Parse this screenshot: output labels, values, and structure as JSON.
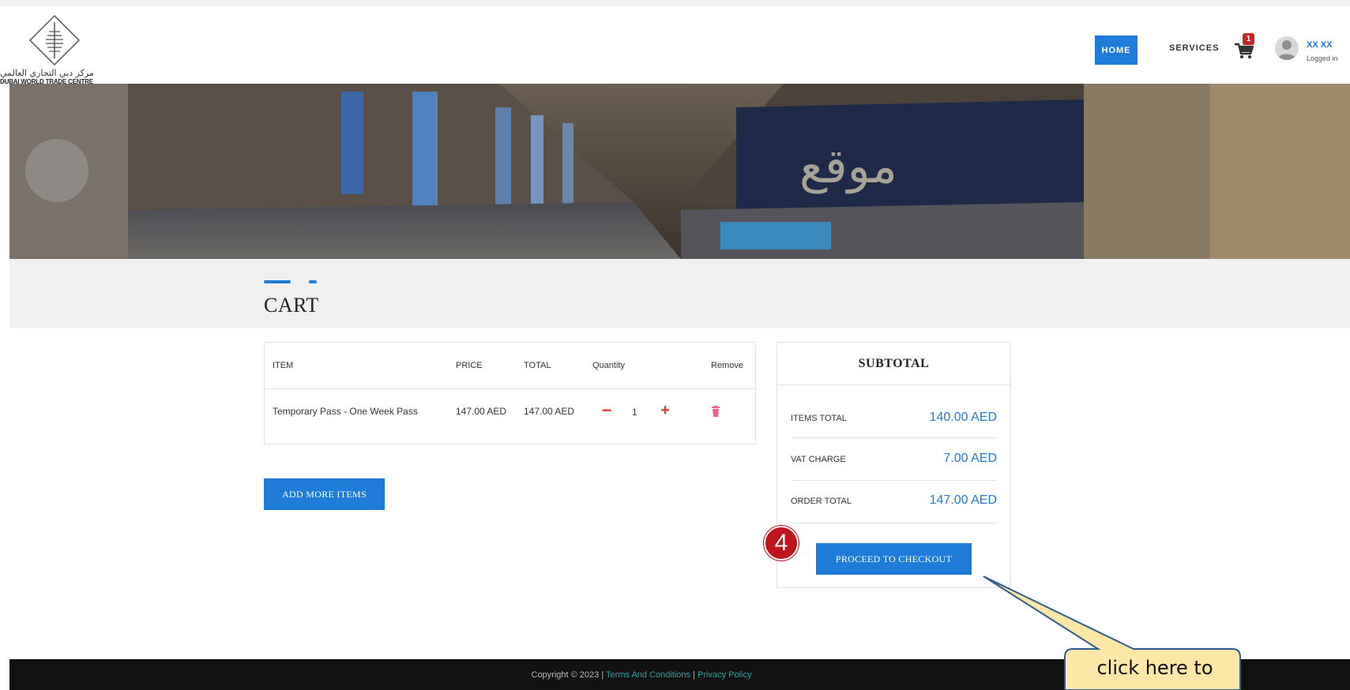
{
  "logo": {
    "arabic_text": "مركز دبي التجاري العالمي",
    "english_text": "DUBAI WORLD TRADE CENTRE"
  },
  "nav": {
    "home_label": "HOME",
    "services_label": "SERVICES",
    "cart_count": "1",
    "user_name": "XX XX",
    "user_status": "Logged in"
  },
  "page": {
    "title": "CART"
  },
  "cart": {
    "columns": [
      "ITEM",
      "PRICE",
      "TOTAL",
      "Quantity",
      "Remove"
    ],
    "rows": [
      {
        "item": "Temporary Pass - One Week Pass",
        "price": "147.00 AED",
        "total": "147.00 AED",
        "quantity": "1",
        "minus_symbol": "−",
        "plus_symbol": "+"
      }
    ],
    "add_more_label": "ADD MORE ITEMS"
  },
  "subtotal": {
    "title": "SUBTOTAL",
    "items_total_label": "ITEMS TOTAL",
    "items_total_value": "140.00 AED",
    "vat_label": "VAT CHARGE",
    "vat_value": "7.00 AED",
    "order_total_label": "ORDER TOTAL",
    "order_total_value": "147.00 AED",
    "checkout_label": "PROCEED TO CHECKOUT"
  },
  "annotation": {
    "step_number": "4",
    "callout_text": "click here to"
  },
  "footer": {
    "copyright": "Copyright © 2023 | ",
    "terms_label": "Terms And Conditions",
    "divider": " | ",
    "privacy_label": "Privacy Policy"
  },
  "colors": {
    "accent": "#1e7bd8",
    "danger": "#e53935",
    "badge": "#c0151d",
    "footer_bg": "#111111",
    "footer_link": "#2aa6a6"
  },
  "icons": [
    "logo-emblem-icon",
    "cart-icon",
    "avatar-icon",
    "trash-icon"
  ]
}
